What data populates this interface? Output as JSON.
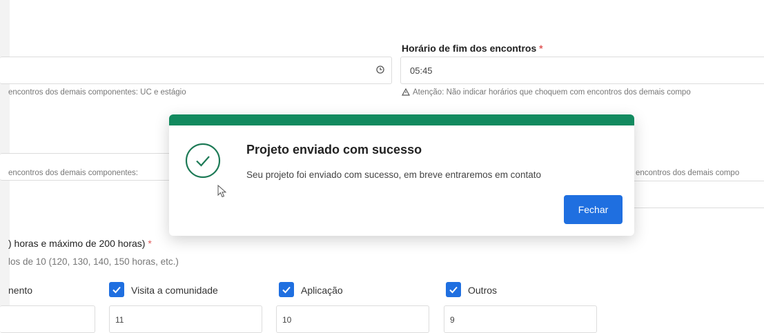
{
  "end_time": {
    "label": "Horário de fim dos encontros",
    "required_mark": "*",
    "value": "05:45",
    "hint": "Atenção: Não indicar horários que choquem com encontros dos demais compo"
  },
  "start_time": {
    "hint_1": "encontros dos demais componentes: UC e estágio",
    "hint_2": "encontros dos demais componentes:"
  },
  "hint_right_2": "encontros dos demais compo",
  "hours": {
    "label": ") horas e máximo de 200 horas)",
    "required_mark": "*",
    "hint": "los de 10 (120, 130, 140, 150 horas, etc.)"
  },
  "activities": {
    "partial_label": "nento",
    "items": [
      {
        "label": "Visita a comunidade",
        "checked": true,
        "value": "11"
      },
      {
        "label": "Aplicação",
        "checked": true,
        "value": "10"
      },
      {
        "label": "Outros",
        "checked": true,
        "value": "9"
      }
    ]
  },
  "modal": {
    "title": "Projeto enviado com sucesso",
    "message": "Seu projeto foi enviado com sucesso, em breve entraremos em contato",
    "close_label": "Fechar",
    "accent_color": "#128a5f",
    "button_color": "#1f6fe0"
  },
  "icons": {
    "clock": "clock-icon",
    "warning": "warning-triangle-icon",
    "success": "check-circle-icon",
    "checkbox": "checkbox-checked-icon",
    "cursor": "mouse-cursor-icon"
  }
}
